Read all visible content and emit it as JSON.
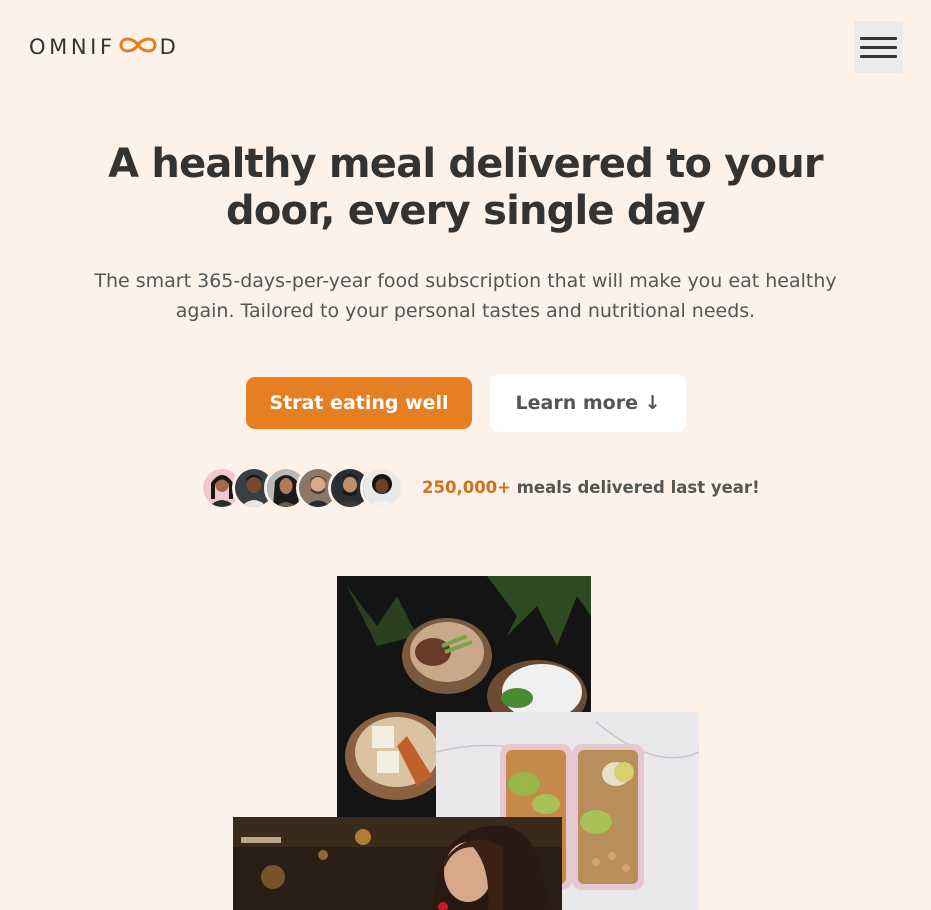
{
  "header": {
    "logo": {
      "part1": "OMNIF",
      "part2": "D"
    },
    "menu_icon": "hamburger-menu-icon"
  },
  "hero": {
    "title": "A healthy meal delivered to your door, every single day",
    "description": "The smart 365-days-per-year food subscription that will make you eat healthy again. Tailored to your personal tastes and nutritional needs.",
    "cta_primary": "Strat eating well",
    "cta_secondary": "Learn more ↓",
    "delivered_count": "250,000+",
    "delivered_text": " meals delivered last year!"
  },
  "colors": {
    "background": "#fdf2e9",
    "accent": "#e67e22",
    "accent_dark": "#cf711f",
    "text": "#333333",
    "text_muted": "#555555"
  }
}
